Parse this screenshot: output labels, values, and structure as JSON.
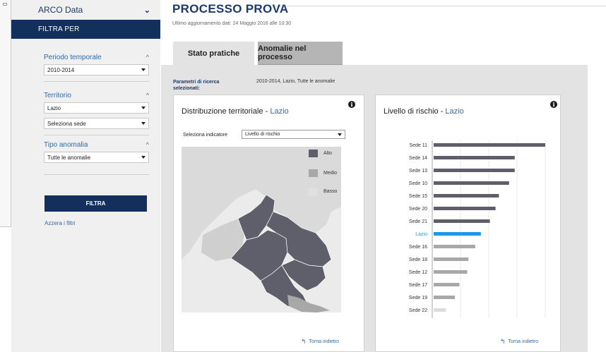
{
  "sidebar": {
    "top_label": "ARCO Data",
    "header": "FILTRA PER",
    "groups": [
      {
        "title": "Periodo temporale",
        "selects": [
          "2010-2014"
        ]
      },
      {
        "title": "Territorio",
        "selects": [
          "Lazio",
          "Seleziona sede"
        ]
      },
      {
        "title": "Tipo anomalia",
        "selects": [
          "Tutte le anomalie"
        ]
      }
    ],
    "filter_button": "FILTRA",
    "reset_link": "Azzera i filtri"
  },
  "main": {
    "title": "PROCESSO PROVA",
    "updated": "Ultimo aggiornamento dati: 24 Maggio 2016 alle 10:30",
    "tabs": [
      {
        "label": "Stato pratiche",
        "active": true
      },
      {
        "label": "Anomalie nel processo",
        "active": false
      }
    ],
    "params": {
      "label": "Parametri di ricerca selezionati:",
      "value": "2010-2014, Lazio, Tutte le anomalie"
    }
  },
  "map_card": {
    "title_prefix": "Distribuzione territoriale - ",
    "title_region": "Lazio",
    "indicator_label": "Seleziona indicatore",
    "indicator_value": "Livello di rischio",
    "legend": [
      {
        "label": "Alto",
        "color": "#5f5f6b"
      },
      {
        "label": "Medio",
        "color": "#a8a8a8"
      },
      {
        "label": "Basso",
        "color": "#e0e0e0"
      }
    ],
    "back": "Torna indietro"
  },
  "chart_card": {
    "title_prefix": "Livello di rischio - ",
    "title_region": "Lazio",
    "back": "Torna indietro"
  },
  "chart_data": {
    "type": "bar",
    "orientation": "horizontal",
    "title": "Livello di rischio - Lazio",
    "categories": [
      "Sede 11",
      "Sede 14",
      "Sede 13",
      "Sede 10",
      "Sede 15",
      "Sede 20",
      "Sede 21",
      "Lazio",
      "Sede 16",
      "Sede 18",
      "Sede 12",
      "Sede 17",
      "Sede 19",
      "Sede 22"
    ],
    "values": [
      100,
      73,
      73,
      68,
      59,
      56,
      51,
      43,
      38,
      32,
      31,
      24,
      20,
      12
    ],
    "levels": [
      "Alto",
      "Alto",
      "Alto",
      "Alto",
      "Alto",
      "Alto",
      "Alto",
      "Regione",
      "Medio",
      "Medio",
      "Medio",
      "Medio",
      "Medio",
      "Basso"
    ],
    "highlight": "Lazio",
    "colors": {
      "Alto": "#5f5f6b",
      "Medio": "#a8a8a8",
      "Basso": "#dcdcdc",
      "Regione": "#1a9ae6"
    },
    "grid": true
  }
}
